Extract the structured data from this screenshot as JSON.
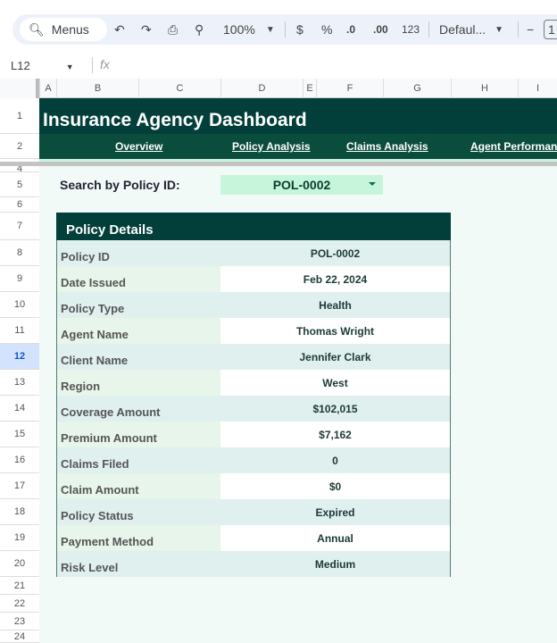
{
  "toolbar": {
    "menus": "Menus",
    "zoom": "100%",
    "currency": "$",
    "percent": "%",
    "dec_decrease": ".0",
    "dec_increase": ".00",
    "number_format": "123",
    "font": "Defaul...",
    "font_size_minus": "−",
    "font_size": "1"
  },
  "formula_bar": {
    "cell_ref": "L12",
    "fx": "fx",
    "value": ""
  },
  "columns": [
    "A",
    "B",
    "C",
    "D",
    "E",
    "F",
    "G",
    "H",
    "I"
  ],
  "rows": [
    "1",
    "2",
    "4",
    "5",
    "6",
    "7",
    "8",
    "9",
    "10",
    "11",
    "12",
    "13",
    "14",
    "15",
    "16",
    "17",
    "18",
    "19",
    "20",
    "21",
    "22",
    "23",
    "24"
  ],
  "selected_row": "12",
  "dashboard": {
    "title": "Insurance Agency Dashboard",
    "nav": [
      "Overview",
      "Policy Analysis",
      "Claims Analysis",
      "Agent Performance"
    ],
    "search_label": "Search by Policy ID:",
    "search_value": "POL-0002",
    "table_title": "Policy Details",
    "details": [
      {
        "label": "Policy ID",
        "value": "POL-0002"
      },
      {
        "label": "Date Issued",
        "value": "Feb 22, 2024"
      },
      {
        "label": "Policy Type",
        "value": "Health"
      },
      {
        "label": "Agent Name",
        "value": "Thomas Wright"
      },
      {
        "label": "Client Name",
        "value": "Jennifer Clark"
      },
      {
        "label": "Region",
        "value": "West"
      },
      {
        "label": "Coverage Amount",
        "value": "$102,015"
      },
      {
        "label": "Premium Amount",
        "value": "$7,162"
      },
      {
        "label": "Claims Filed",
        "value": "0"
      },
      {
        "label": "Claim Amount",
        "value": "$0"
      },
      {
        "label": "Policy Status",
        "value": "Expired"
      },
      {
        "label": "Payment Method",
        "value": "Annual"
      },
      {
        "label": "Risk Level",
        "value": "Medium"
      }
    ]
  },
  "colors": {
    "header_bg": "#023f3a",
    "nav_bg": "#0a4d3c",
    "dropdown_bg": "#c6f5dc",
    "sheet_bg": "#f2faf7"
  }
}
